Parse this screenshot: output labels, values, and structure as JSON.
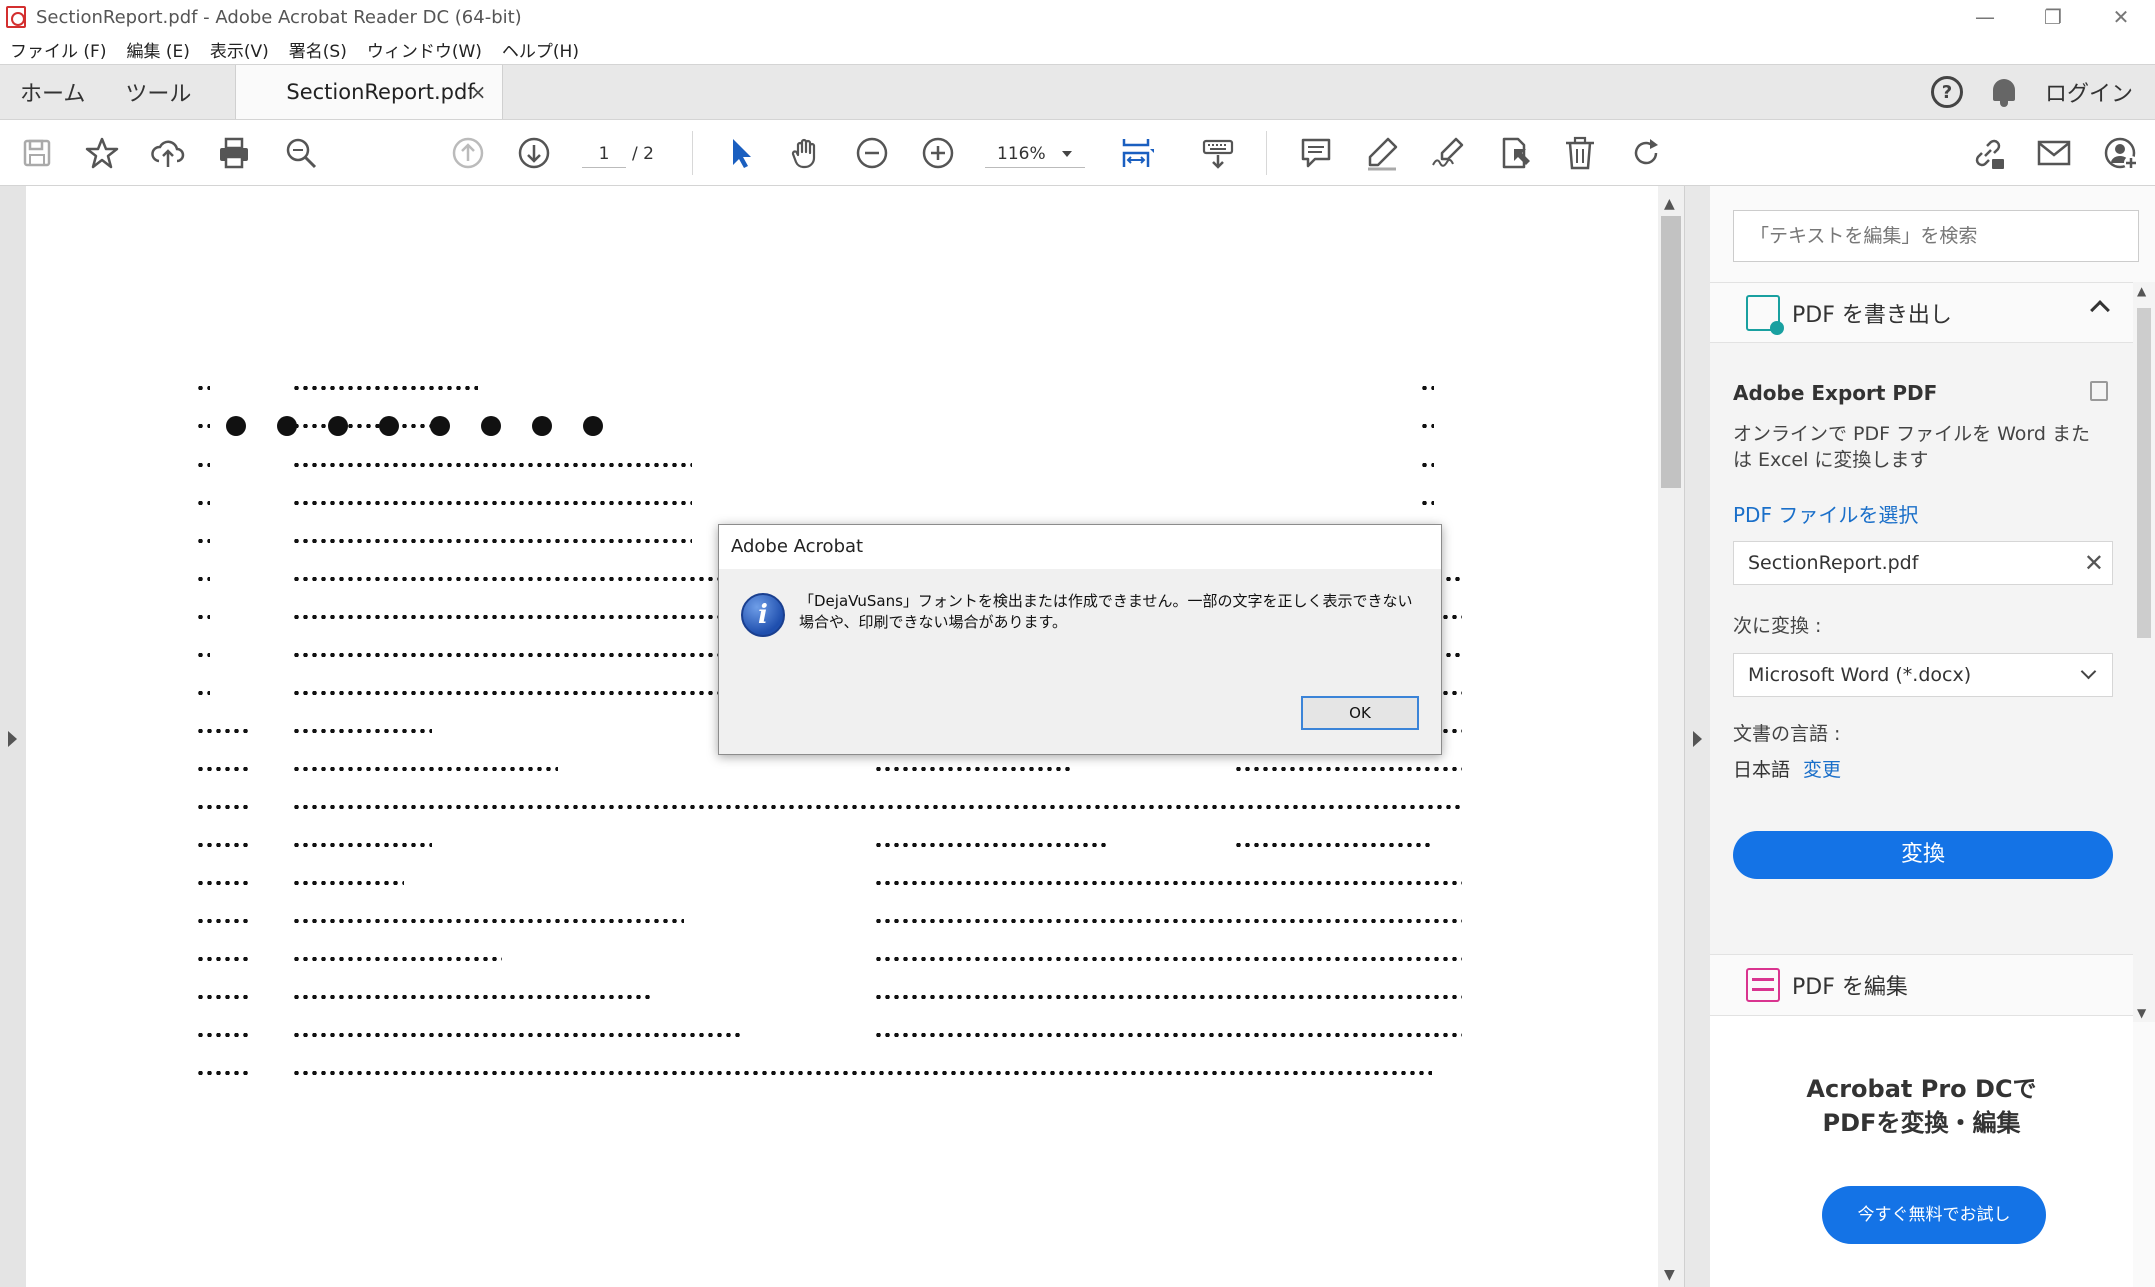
{
  "window": {
    "title": "SectionReport.pdf - Adobe Acrobat Reader DC (64-bit)",
    "minimize": "—",
    "restore": "❐",
    "close": "✕"
  },
  "menu": [
    "ファイル (F)",
    "編集 (E)",
    "表示(V)",
    "署名(S)",
    "ウィンドウ(W)",
    "ヘルプ(H)"
  ],
  "tabs": {
    "home": "ホーム",
    "tools": "ツール",
    "document": "SectionReport.pdf",
    "close": "×",
    "help": "?",
    "login": "ログイン"
  },
  "toolbar": {
    "page_current": "1",
    "page_total": "/ 2",
    "zoom": "116%",
    "icons": [
      "save-icon",
      "star-icon",
      "upload-icon",
      "print-icon",
      "search-zoom-icon",
      "page-up-icon",
      "page-down-icon",
      "select-cursor-icon",
      "hand-icon",
      "zoom-out-icon",
      "zoom-in-icon",
      "fit-page-icon",
      "keyboard-icon",
      "comment-icon",
      "highlight-icon",
      "sign-icon",
      "stamp-icon",
      "delete-icon",
      "rotate-icon",
      "link-icon",
      "mail-icon",
      "add-user-icon"
    ]
  },
  "right_panel": {
    "search_placeholder": "「テキストを編集」を検索",
    "export_section": "PDF を書き出し",
    "export_title": "Adobe Export PDF",
    "export_desc": "オンラインで PDF ファイルを Word または Excel に変換します",
    "select_file": "PDF ファイルを選択",
    "file_name": "SectionReport.pdf",
    "file_clear": "✕",
    "convert_to_label": "次に変換 :",
    "format": "Microsoft Word (*.docx)",
    "language_label": "文書の言語 :",
    "language": "日本語",
    "language_change": "変更",
    "convert_button": "変換",
    "edit_section": "PDF を編集",
    "promo_line1": "Acrobat Pro DCで",
    "promo_line2": "PDFを変換・編集",
    "promo_button": "今すぐ無料でお試し"
  },
  "dialog": {
    "title": "Adobe Acrobat",
    "icon": "i",
    "message": "「DejaVuSans」フォントを検出または作成できません。一部の文字を正しく表示できない場合や、印刷できない場合があります。",
    "ok": "OK"
  },
  "colors": {
    "accent_blue": "#1473e6",
    "link_blue": "#1a6fc9",
    "export_teal": "#19a0a0",
    "edit_pink": "#d9348f",
    "select_tool_blue": "#1a5fc0"
  }
}
